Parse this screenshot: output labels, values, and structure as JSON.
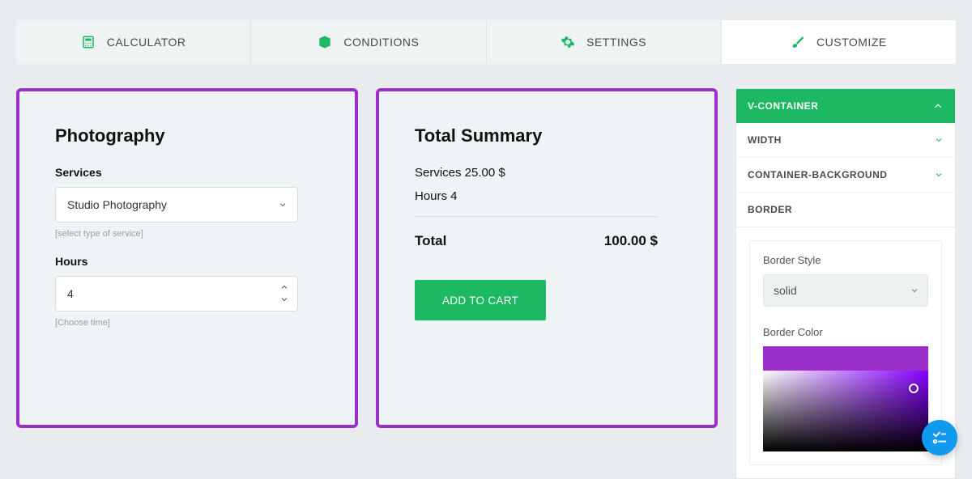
{
  "tabs": {
    "calculator": "CALCULATOR",
    "conditions": "CONDITIONS",
    "settings": "SETTINGS",
    "customize": "CUSTOMIZE"
  },
  "form": {
    "title": "Photography",
    "services_label": "Services",
    "services_value": "Studio Photography",
    "services_hint": "[select type of service]",
    "hours_label": "Hours",
    "hours_value": "4",
    "hours_hint": "[Choose time]"
  },
  "summary": {
    "title": "Total Summary",
    "line1": "Services 25.00 $",
    "line2": "Hours 4",
    "total_label": "Total",
    "total_value": "100.00 $",
    "button": "ADD TO CART"
  },
  "sidebar": {
    "header": "V-CONTAINER",
    "width": "WIDTH",
    "bg": "CONTAINER-BACKGROUND",
    "border": "BORDER",
    "border_style_label": "Border Style",
    "border_style_value": "solid",
    "border_color_label": "Border Color"
  },
  "colors": {
    "accent": "#9a2fc9",
    "primary": "#1db862"
  }
}
